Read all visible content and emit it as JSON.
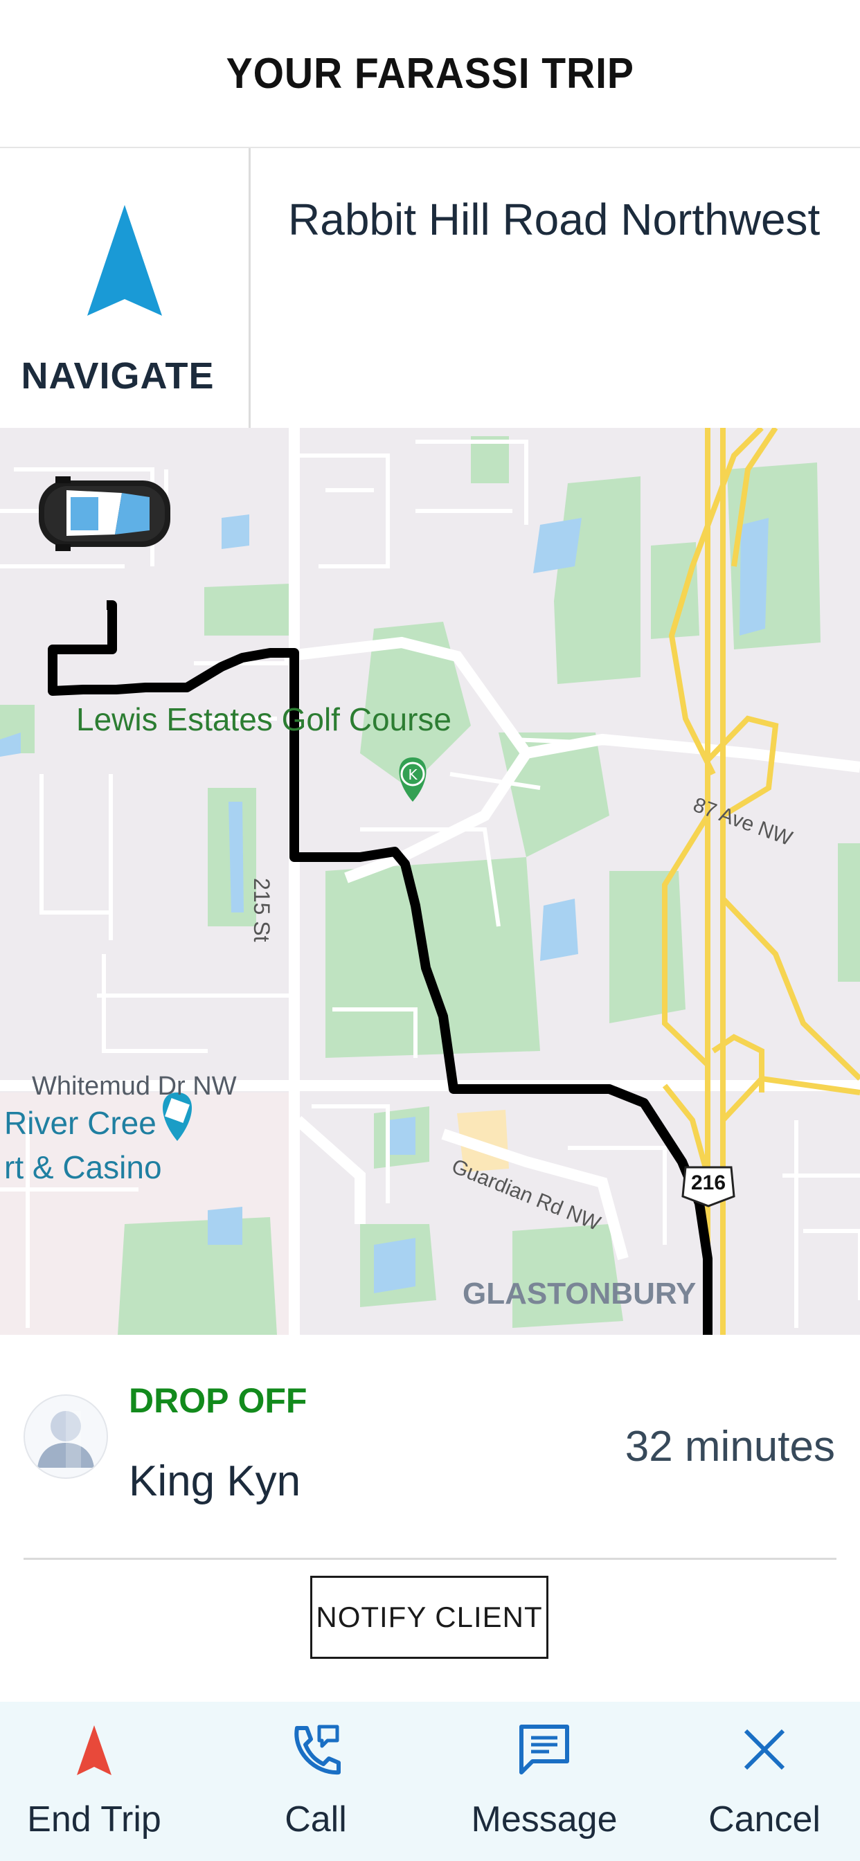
{
  "header": {
    "title": "YOUR FARASSI TRIP"
  },
  "navigation": {
    "button_label": "NAVIGATE",
    "destination": "Rabbit Hill Road Northwest"
  },
  "map": {
    "labels": {
      "golf_course": "Lewis Estates Golf Course",
      "road_215": "215 St",
      "road_87ave": "87 Ave NW",
      "whitemud": "Whitemud Dr NW",
      "river_cree_line1": "River Cree",
      "river_cree_line2": "rt & Casino",
      "guardian": "Guardian Rd NW",
      "glastonbury": "GLASTONBURY",
      "highway_shield": "216"
    }
  },
  "trip": {
    "status": "DROP OFF",
    "client_name": "King Kyn",
    "eta": "32 minutes",
    "notify_label": "NOTIFY CLIENT"
  },
  "bottom_bar": {
    "items": [
      {
        "label": "End Trip",
        "icon": "navigation-arrow-icon"
      },
      {
        "label": "Call",
        "icon": "phone-icon"
      },
      {
        "label": "Message",
        "icon": "message-icon"
      },
      {
        "label": "Cancel",
        "icon": "close-icon"
      }
    ]
  },
  "colors": {
    "accent_blue": "#1a9ad6",
    "drop_off_green": "#128a1c",
    "end_trip_red": "#e8493a",
    "bottom_bar_bg": "#eef8fb"
  }
}
